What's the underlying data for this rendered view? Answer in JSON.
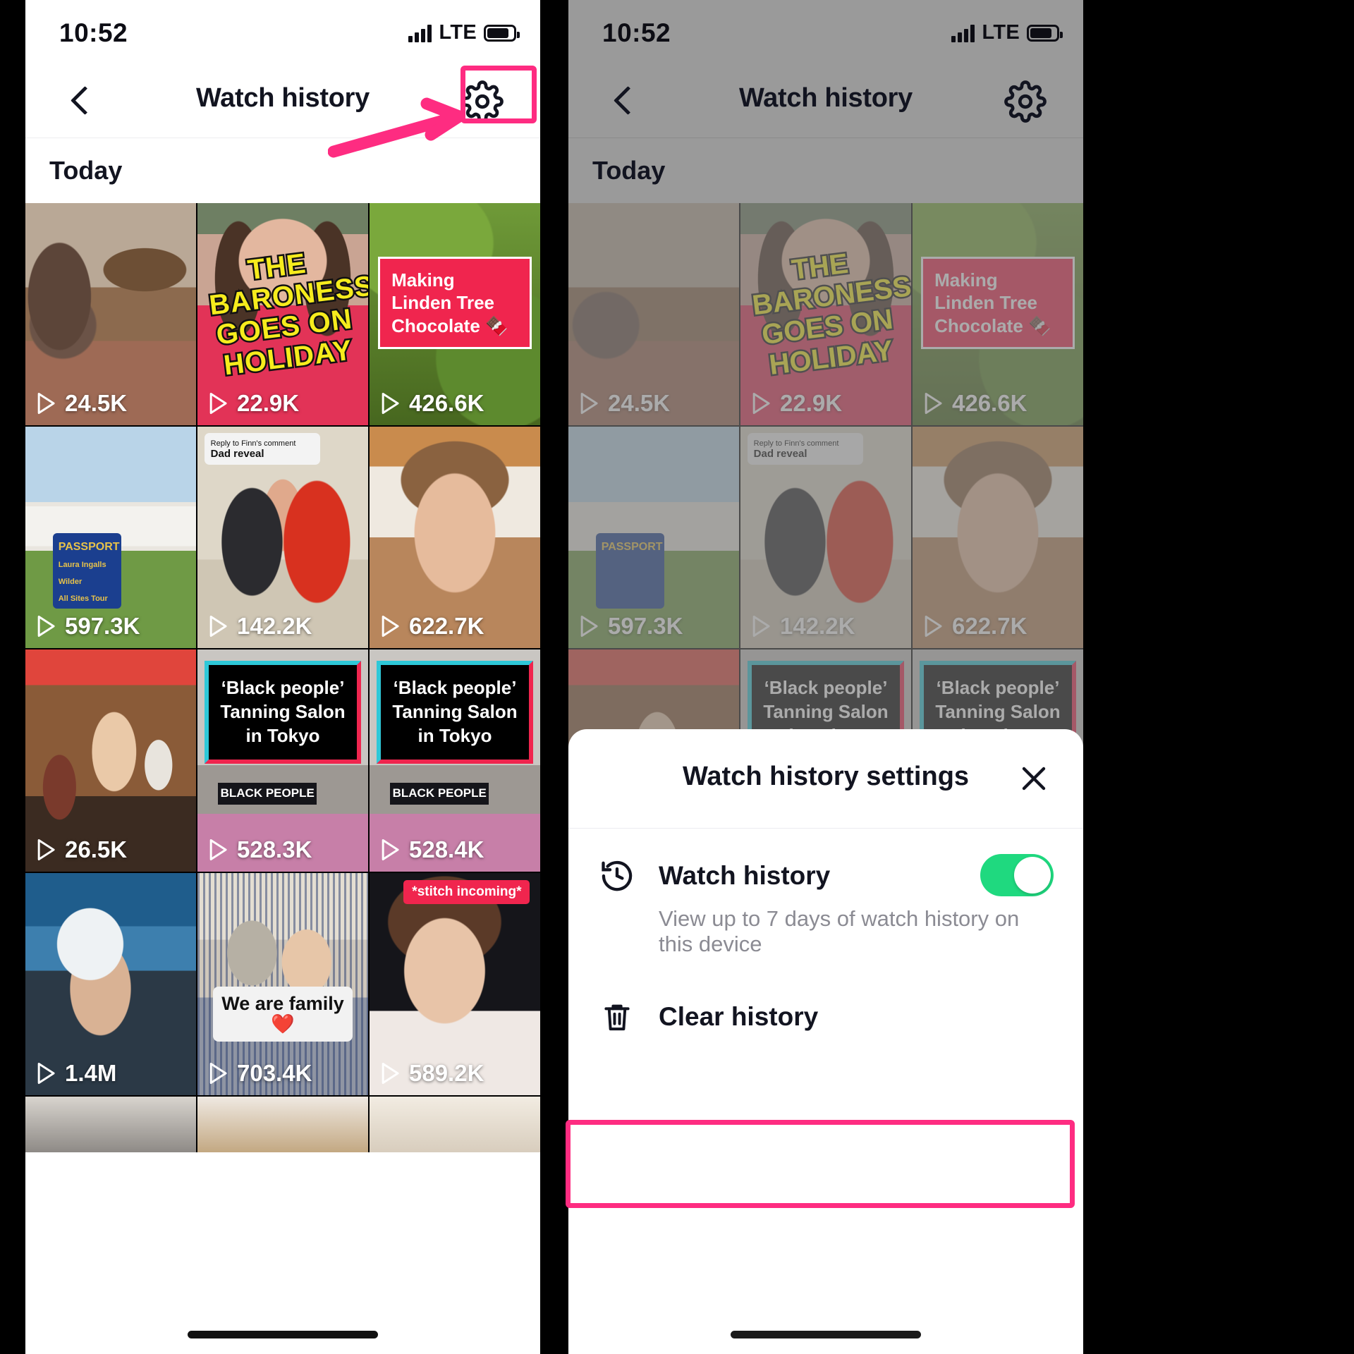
{
  "status_bar": {
    "time": "10:52",
    "network": "LTE",
    "signal_icon": "cellular-signal-icon",
    "battery_icon": "battery-icon"
  },
  "nav": {
    "back_icon": "chevron-left-icon",
    "title": "Watch history",
    "gear_icon": "gear-icon"
  },
  "section_header": "Today",
  "annotations": {
    "arrow_color": "#fe2c81",
    "highlight_color": "#fe2c81",
    "gear_highlight": "settings-gear-highlight",
    "clear_history_highlight": "clear-history-highlight"
  },
  "videos": [
    {
      "views": "24.5K",
      "caption": "",
      "id": "video-cat"
    },
    {
      "views": "22.9K",
      "caption": "THE BARONESS GOES ON HOLIDAY",
      "id": "video-baroness"
    },
    {
      "views": "426.6K",
      "caption": "Making Linden Tree Chocolate 🍫",
      "id": "video-linden"
    },
    {
      "views": "597.3K",
      "caption": "PASSPORT",
      "id": "video-passport"
    },
    {
      "views": "142.2K",
      "caption": "Dad reveal",
      "id": "video-dad-reveal"
    },
    {
      "views": "622.7K",
      "caption": "",
      "id": "video-teen"
    },
    {
      "views": "26.5K",
      "caption": "",
      "id": "video-rabbit"
    },
    {
      "views": "528.3K",
      "caption": "‘Black people’ Tanning Salon in Tokyo",
      "id": "video-tanning-1"
    },
    {
      "views": "528.4K",
      "caption": "‘Black people’ Tanning Salon in Tokyo",
      "id": "video-tanning-2"
    },
    {
      "views": "1.4M",
      "caption": "",
      "id": "video-car"
    },
    {
      "views": "703.4K",
      "caption": "We are family ❤️",
      "id": "video-family"
    },
    {
      "views": "589.2K",
      "caption": "*stitch incoming*",
      "id": "video-stitch"
    }
  ],
  "video_sub_captions": {
    "dad_reveal_reply": "Reply to Finn's comment",
    "dad_reveal_title": "Dad reveal",
    "passport_line1": "PASSPORT",
    "passport_line2": "Laura Ingalls Wilder",
    "passport_line3": "All Sites Tour",
    "black_people_sign": "BLACK PEOPLE"
  },
  "sheet": {
    "title": "Watch history settings",
    "close_icon": "close-x-icon",
    "watch_history": {
      "icon": "history-clock-icon",
      "label": "Watch history",
      "description": "View up to 7 days of watch history on this device",
      "toggle_state": "on",
      "toggle_color": "#1fd97f"
    },
    "clear_history": {
      "icon": "trash-bin-icon",
      "label": "Clear history"
    }
  }
}
